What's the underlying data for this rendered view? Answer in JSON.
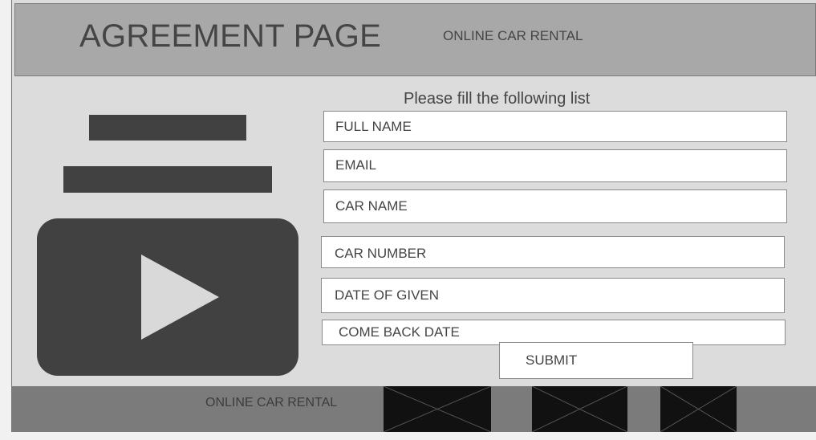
{
  "header": {
    "title": "AGREEMENT PAGE",
    "subtitle": "ONLINE CAR RENTAL"
  },
  "form": {
    "instruction": "Please fill the following list",
    "fields": [
      {
        "label": "FULL NAME"
      },
      {
        "label": "EMAIL"
      },
      {
        "label": "CAR NAME"
      },
      {
        "label": "CAR NUMBER"
      },
      {
        "label": "DATE OF GIVEN"
      },
      {
        "label": "COME BACK DATE"
      }
    ],
    "submit_label": "SUBMIT"
  },
  "media": {
    "video_icon": "play-icon"
  },
  "footer": {
    "text": "ONLINE CAR RENTAL"
  },
  "colors": {
    "background": "#dcdcdc",
    "header": "#a8a8a8",
    "footer": "#7b7b7b",
    "placeholder": "#414141",
    "image_placeholder": "#111111"
  }
}
